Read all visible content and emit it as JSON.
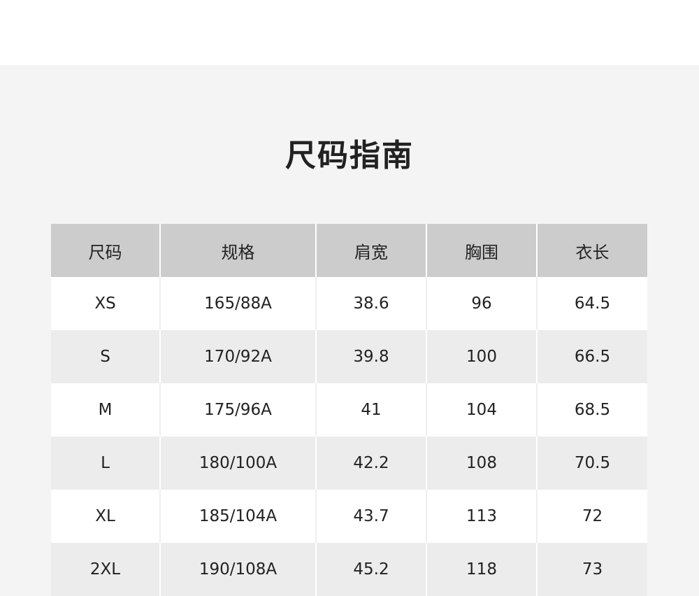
{
  "title": "尺码指南",
  "table": {
    "headers": [
      "尺码",
      "规格",
      "肩宽",
      "胸围",
      "衣长"
    ],
    "rows": [
      [
        "XS",
        "165/88A",
        "38.6",
        "96",
        "64.5"
      ],
      [
        "S",
        "170/92A",
        "39.8",
        "100",
        "66.5"
      ],
      [
        "M",
        "175/96A",
        "41",
        "104",
        "68.5"
      ],
      [
        "L",
        "180/100A",
        "42.2",
        "108",
        "70.5"
      ],
      [
        "XL",
        "185/104A",
        "43.7",
        "113",
        "72"
      ],
      [
        "2XL",
        "190/108A",
        "45.2",
        "118",
        "73"
      ]
    ]
  }
}
